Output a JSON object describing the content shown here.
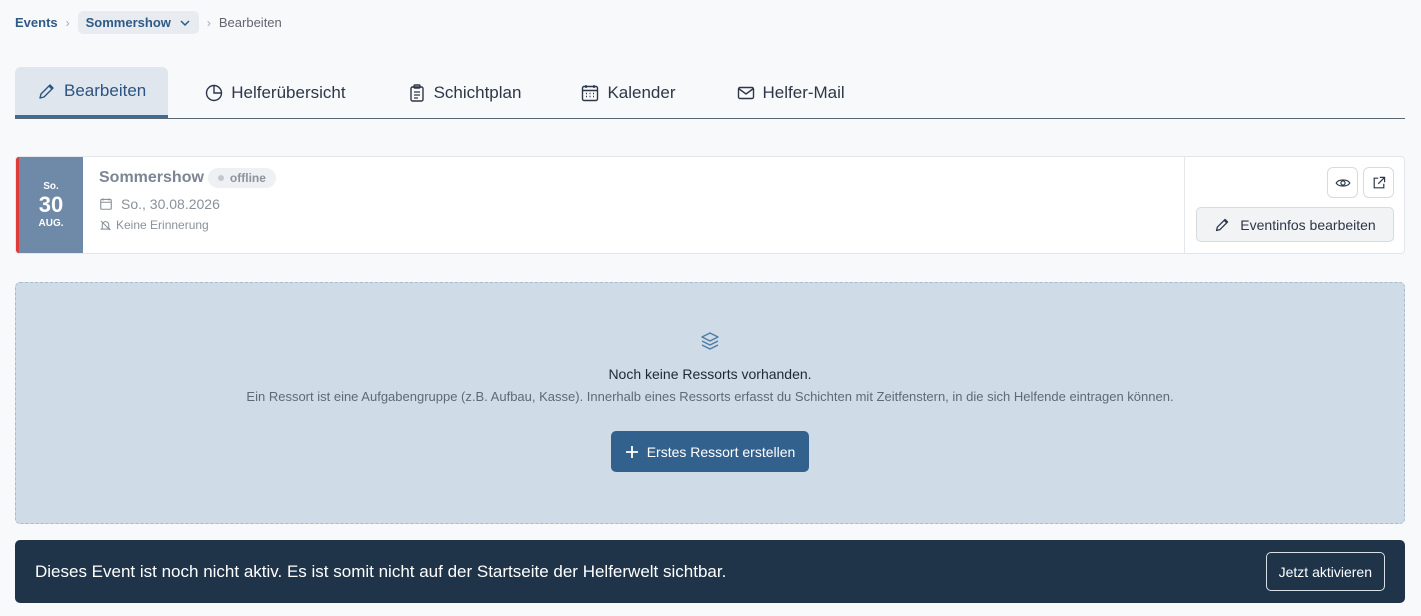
{
  "breadcrumb": {
    "root": "Events",
    "event": "Sommershow",
    "current": "Bearbeiten"
  },
  "tabs": [
    {
      "label": "Bearbeiten",
      "icon": "pencil-icon",
      "active": true
    },
    {
      "label": "Helferübersicht",
      "icon": "pie-chart-icon"
    },
    {
      "label": "Schichtplan",
      "icon": "clipboard-icon"
    },
    {
      "label": "Kalender",
      "icon": "calendar-icon"
    },
    {
      "label": "Helfer-Mail",
      "icon": "mail-icon"
    }
  ],
  "event": {
    "date_box": {
      "dow": "So.",
      "day": "30",
      "month": "AUG."
    },
    "title": "Sommershow",
    "status": "offline",
    "date": "So., 30.08.2026",
    "reminder": "Keine Erinnerung",
    "edit_button": "Eventinfos bearbeiten"
  },
  "empty_state": {
    "title": "Noch keine Ressorts vorhanden.",
    "description": "Ein Ressort ist eine Aufgabengruppe (z.B. Aufbau, Kasse). Innerhalb eines Ressorts erfasst du Schichten mit Zeitfenstern, in die sich Helfende eintragen können.",
    "button": "Erstes Ressort erstellen"
  },
  "banner": {
    "text": "Dieses Event ist noch nicht aktiv. Es ist somit nicht auf der Startseite der Helferwelt sichtbar.",
    "button": "Jetzt aktivieren"
  },
  "colors": {
    "primary": "#33618e",
    "banner_bg": "#1f3349",
    "date_box": "#6e8aa8",
    "accent_red": "#e03b3b"
  }
}
